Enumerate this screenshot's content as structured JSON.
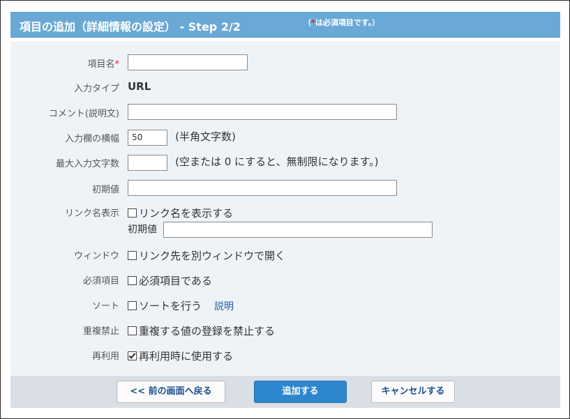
{
  "header": {
    "title": "項目の追加（詳細情報の設定） - Step 2/2",
    "note_open": "（",
    "note_star": "*",
    "note_rest": "は必須項目です。）"
  },
  "form": {
    "item_name": {
      "label": "項目名",
      "required_mark": "*",
      "value": ""
    },
    "input_type": {
      "label": "入力タイプ",
      "value": "URL"
    },
    "comment": {
      "label": "コメント(説明文)",
      "value": ""
    },
    "width": {
      "label": "入力欄の横幅",
      "value": "50",
      "hint": "(半角文字数)"
    },
    "max_length": {
      "label": "最大入力文字数",
      "value": "",
      "hint": "(空または 0 にすると、無制限になります。)"
    },
    "initial_value": {
      "label": "初期値",
      "value": ""
    },
    "link_name": {
      "label": "リンク名表示",
      "checkbox_label": "リンク名を表示する",
      "checked": false,
      "sub_label": "初期値",
      "sub_value": ""
    },
    "window": {
      "label": "ウィンドウ",
      "checkbox_label": "リンク先を別ウィンドウで開く",
      "checked": false
    },
    "required": {
      "label": "必須項目",
      "checkbox_label": "必須項目である",
      "checked": false
    },
    "sort": {
      "label": "ソート",
      "checkbox_label": "ソートを行う",
      "checked": false,
      "link": "説明"
    },
    "no_duplicate": {
      "label": "重複禁止",
      "checkbox_label": "重複する値の登録を禁止する",
      "checked": false
    },
    "reuse": {
      "label": "再利用",
      "checkbox_label": "再利用時に使用する",
      "checked": true
    }
  },
  "footer": {
    "back_label": "<< 前の画面へ戻る",
    "add_label": "追加する",
    "cancel_label": "キャンセルする"
  }
}
